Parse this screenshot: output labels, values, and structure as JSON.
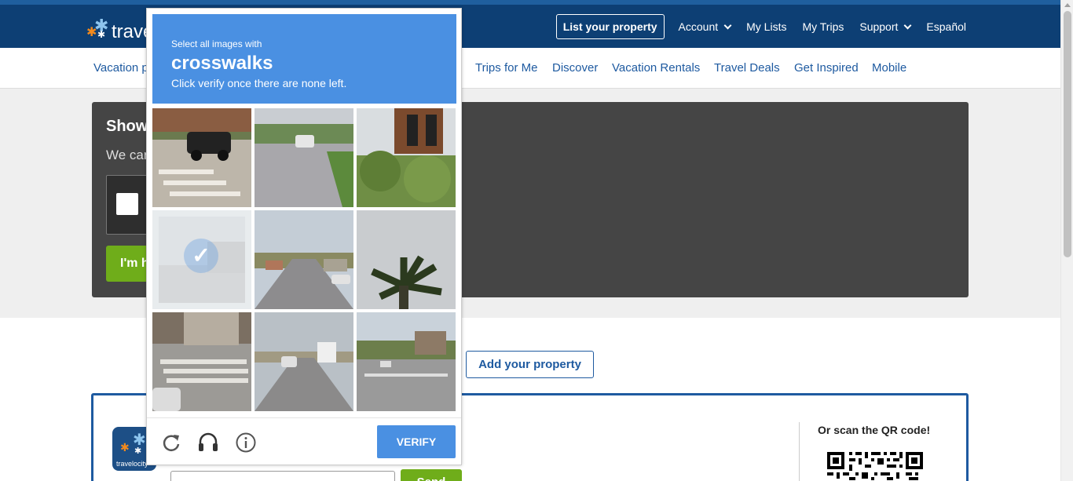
{
  "header": {
    "logo_text": "trave",
    "list_property": "List your property",
    "links": [
      {
        "label": "Account",
        "dropdown": true
      },
      {
        "label": "My Lists",
        "dropdown": false
      },
      {
        "label": "My Trips",
        "dropdown": false
      },
      {
        "label": "Support",
        "dropdown": true
      },
      {
        "label": "Español",
        "dropdown": false
      }
    ]
  },
  "subnav": {
    "items": [
      "Vacation p",
      "Trips for Me",
      "Discover",
      "Vacation Rentals",
      "Travel Deals",
      "Get Inspired",
      "Mobile"
    ]
  },
  "panel": {
    "title": "Show",
    "text": "We car",
    "button": "I'm h"
  },
  "add_property": "Add your property",
  "app": {
    "icon_text": "travelocity",
    "qr_label": "Or scan the QR code!",
    "send_button": "Send"
  },
  "captcha": {
    "instruction_small": "Select all images with",
    "target": "crosswalks",
    "instruction_sub": "Click verify once there are none left.",
    "verify_label": "VERIFY",
    "selected_tile_index": 3,
    "tiles": [
      "car-on-crosswalk",
      "road-with-van",
      "traffic-light-trees",
      "faded-street-selected",
      "road-palms",
      "palm-tree",
      "crosswalk-corner",
      "truck-on-road",
      "intersection"
    ],
    "icons": [
      "reload-icon",
      "audio-icon",
      "info-icon"
    ]
  },
  "colors": {
    "header_bg": "#0d3f74",
    "link_blue": "#1e5aa0",
    "captcha_blue": "#4a90e2",
    "green_button": "#6fad1a",
    "panel_dark": "#454545"
  }
}
